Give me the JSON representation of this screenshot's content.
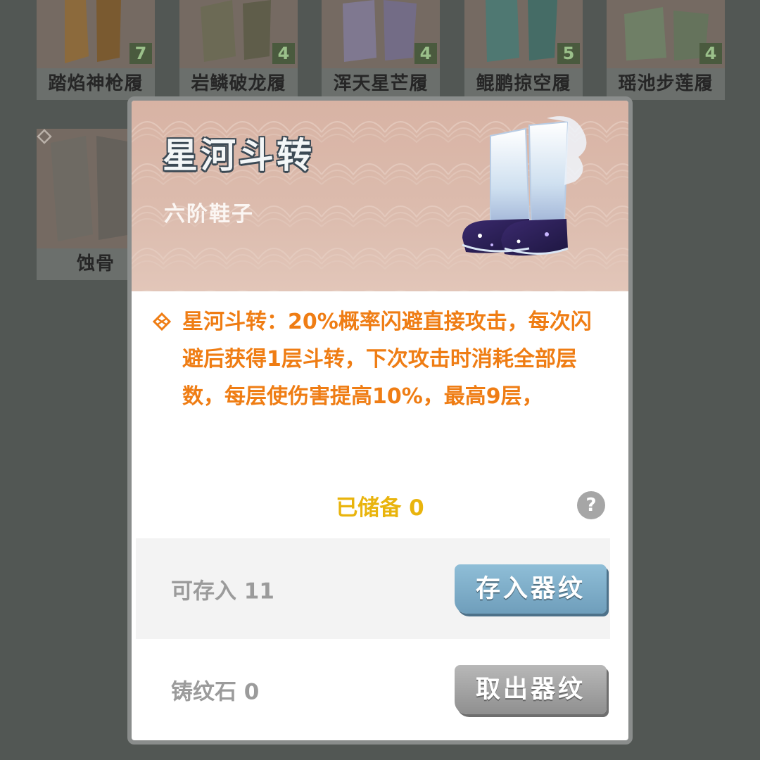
{
  "background_grid": {
    "items": [
      {
        "name": "踏焰神枪履",
        "count": "7"
      },
      {
        "name": "岩鳞破龙履",
        "count": "4"
      },
      {
        "name": "浑天星芒履",
        "count": "4"
      },
      {
        "name": "鲲鹏掠空履",
        "count": "5"
      },
      {
        "name": "瑶池步莲履",
        "count": "4"
      },
      {
        "name": "蚀骨",
        "count": ""
      }
    ]
  },
  "modal": {
    "title": "星河斗转",
    "subtitle": "六阶鞋子",
    "effect_text": "星河斗转：20%概率闪避直接攻击，每次闪避后获得1层斗转，下次攻击时消耗全部层数，每层使伤害提高10%，最高9层，",
    "stored_label": "已储备 0",
    "help_label": "?",
    "deposit": {
      "label": "可存入 11",
      "button": "存入器纹"
    },
    "withdraw": {
      "label": "铸纹石 0",
      "button": "取出器纹"
    }
  },
  "colors": {
    "effect": "#ef7d14",
    "stored": "#e9b40d",
    "deposit_button": "#7eaecb",
    "withdraw_button": "#a3a3a3"
  },
  "icons": {
    "effect": "rune-icon",
    "help": "question-icon"
  }
}
